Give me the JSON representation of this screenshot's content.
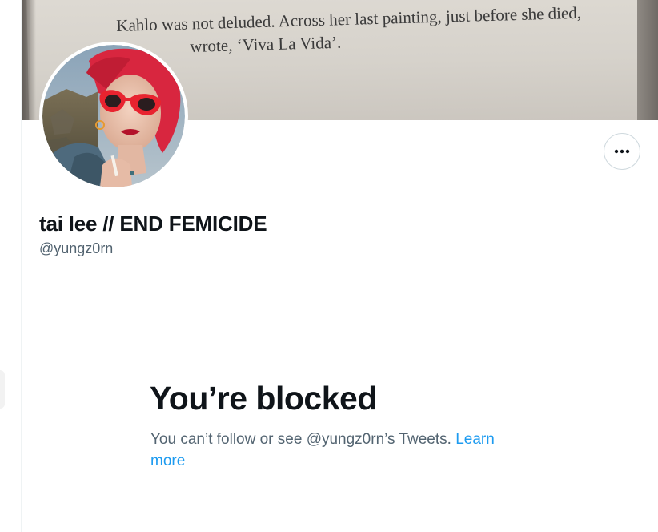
{
  "banner": {
    "text_line_1": "Kahlo was not deluded. Across her last painting, just before she died,",
    "text_line_2": "wrote, ‘Viva La Vida’."
  },
  "profile": {
    "display_name": "tai lee // END FEMICIDE",
    "handle": "@yungz0rn",
    "avatar_icon": "profile-photo"
  },
  "more_button": {
    "icon": "more-horizontal-icon"
  },
  "blocked": {
    "title": "You’re blocked",
    "message": "You can’t follow or see @yungz0rn’s Tweets. ",
    "link_label": "Learn more"
  },
  "colors": {
    "primary_text": "#0f1419",
    "secondary_text": "#536471",
    "link": "#1d9bf0",
    "border": "#cfd9de"
  }
}
